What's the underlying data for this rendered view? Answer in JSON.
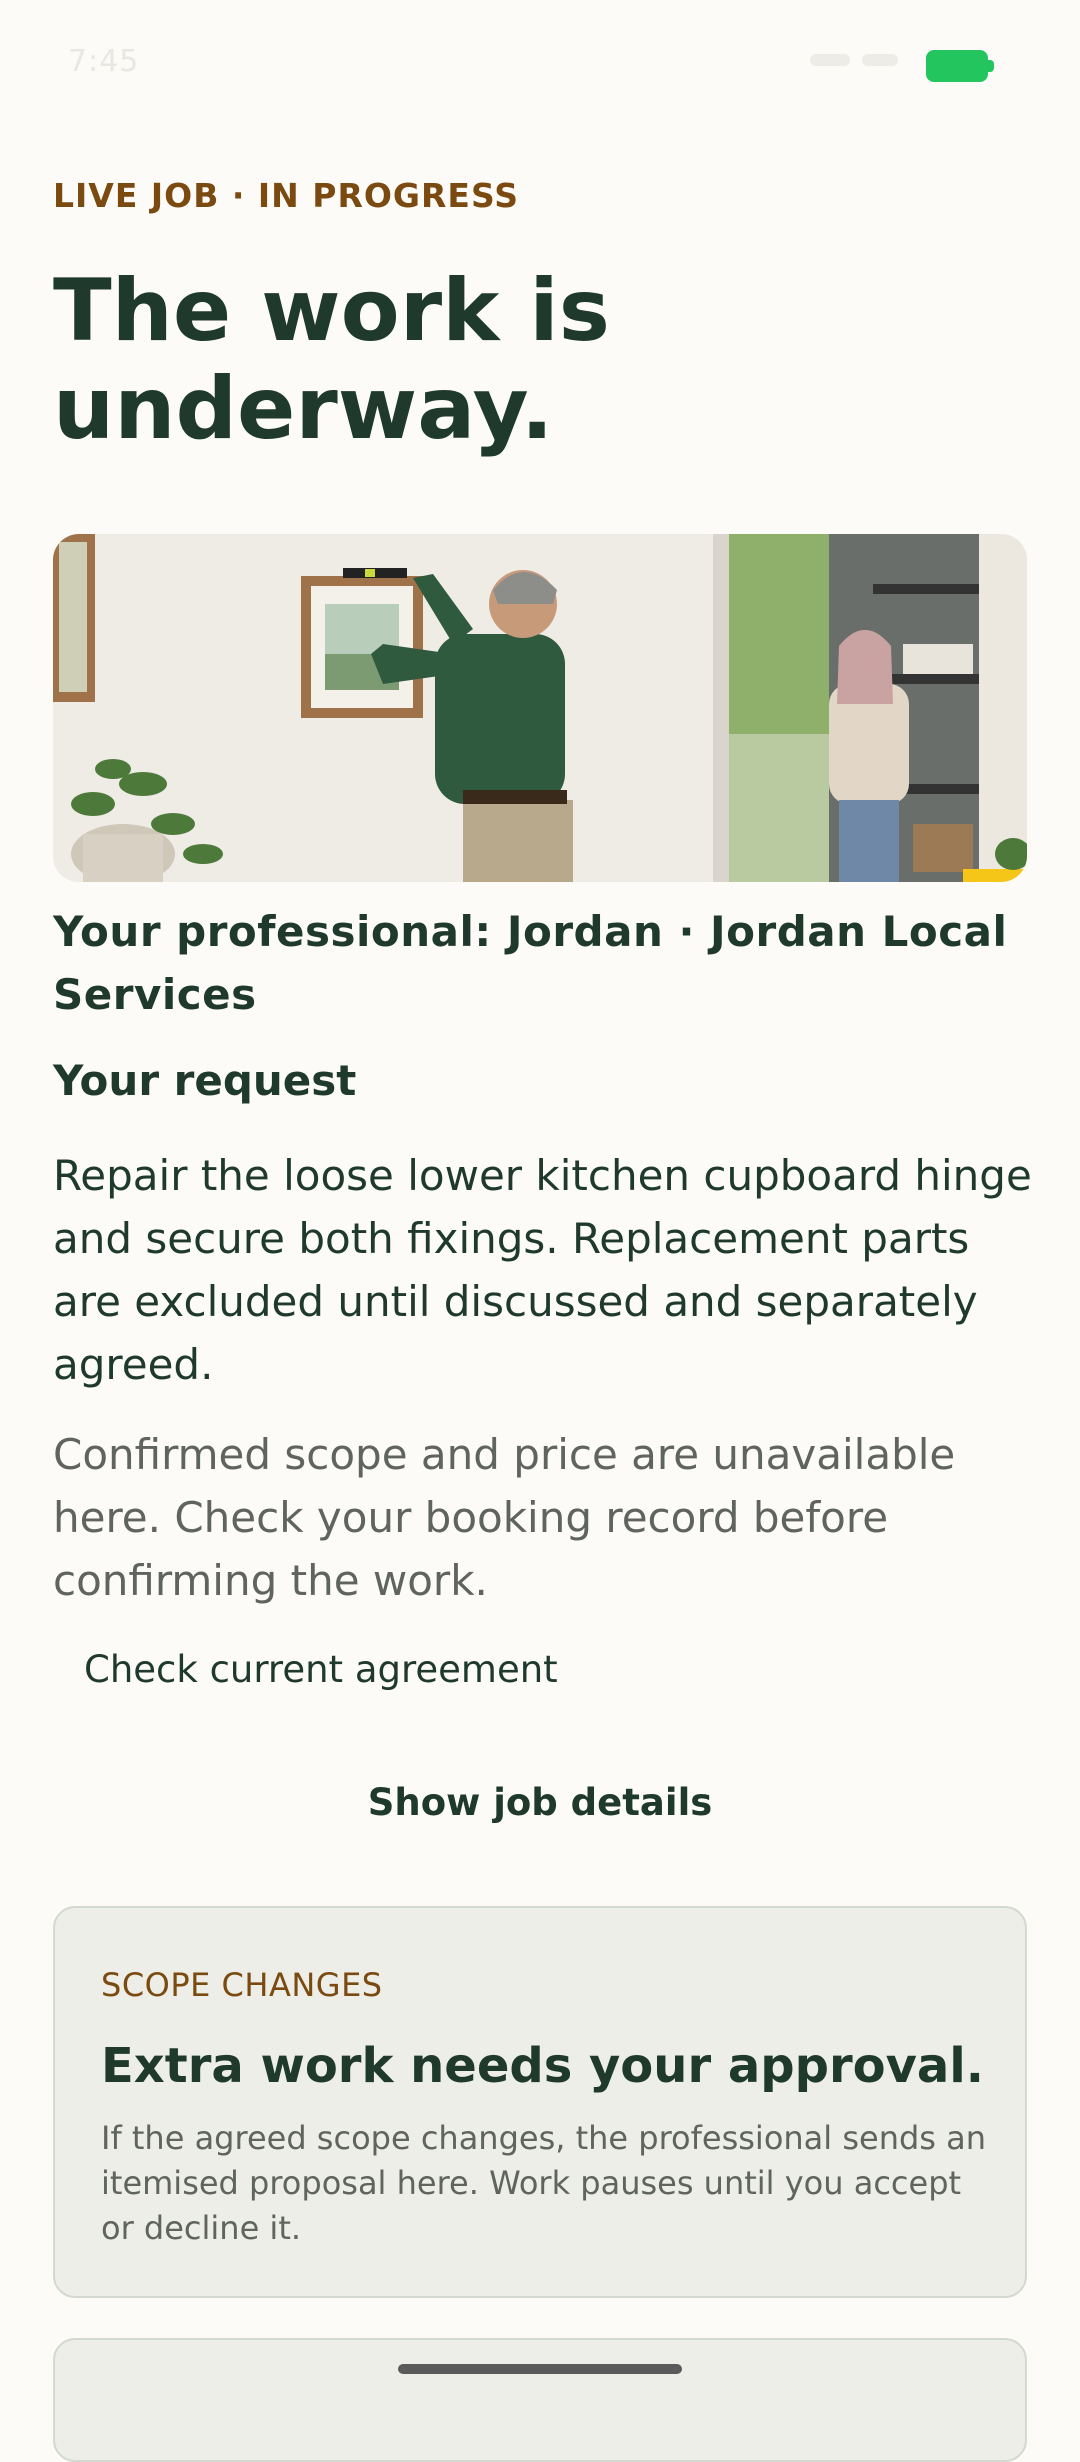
{
  "status_bar": {
    "time": "7:45",
    "battery_color": "#22c55e"
  },
  "header": {
    "eyebrow": "LIVE JOB · IN PROGRESS",
    "headline": "The work is underway."
  },
  "hero": {
    "description_icon": "hero-photo"
  },
  "professional": {
    "text": "Your professional: Jordan · Jordan Local Services"
  },
  "request": {
    "title": "Your request",
    "body": "Repair the loose lower kitchen cupboard hinge and secure both fixings. Replacement parts are excluded until discussed and separately agreed."
  },
  "note": "Confirmed scope and price are unavailable here. Check your booking record before confirming the work.",
  "actions": {
    "agreement_link": "Check current agreement",
    "details_button": "Show job details"
  },
  "scope_card": {
    "eyebrow": "SCOPE CHANGES",
    "title": "Extra work needs your approval.",
    "body": "If the agreed scope changes, the professional sends an itemised proposal here. Work pauses until you accept or decline it."
  },
  "colors": {
    "accent": "#1f3a2d",
    "eyebrow": "#7a4a10",
    "card_bg": "#eceee7"
  }
}
